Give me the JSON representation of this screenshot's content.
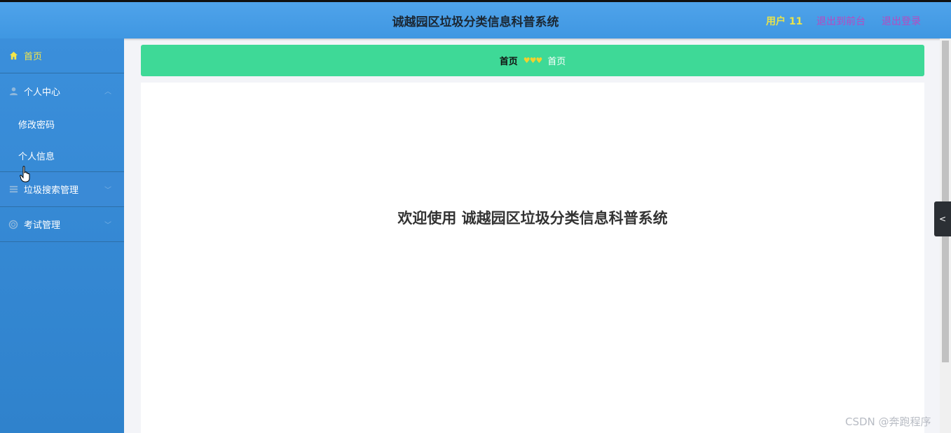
{
  "header": {
    "title": "诚越园区垃圾分类信息科普系统",
    "user": "用户 11",
    "back_to_front": "退出到前台",
    "logout": "退出登录"
  },
  "sidebar": {
    "items": [
      {
        "label": "首页",
        "icon": "home-icon",
        "active": true
      },
      {
        "label": "个人中心",
        "icon": "user-icon",
        "expanded": true,
        "children": [
          {
            "label": "修改密码"
          },
          {
            "label": "个人信息"
          }
        ]
      },
      {
        "label": "垃圾搜索管理",
        "icon": "list-icon"
      },
      {
        "label": "考试管理",
        "icon": "exam-icon"
      }
    ]
  },
  "breadcrumb": {
    "first": "首页",
    "separator": "♥♥♥",
    "current": "首页"
  },
  "main": {
    "welcome": "欢迎使用 诚越园区垃圾分类信息科普系统"
  },
  "watermark": "CSDN @奔跑程序",
  "colors": {
    "header": "#4a9fe8",
    "sidebar": "#3489d6",
    "breadcrumb_bar": "#3ed997",
    "active_menu": "#f4e64a",
    "link": "#b74ac0"
  }
}
